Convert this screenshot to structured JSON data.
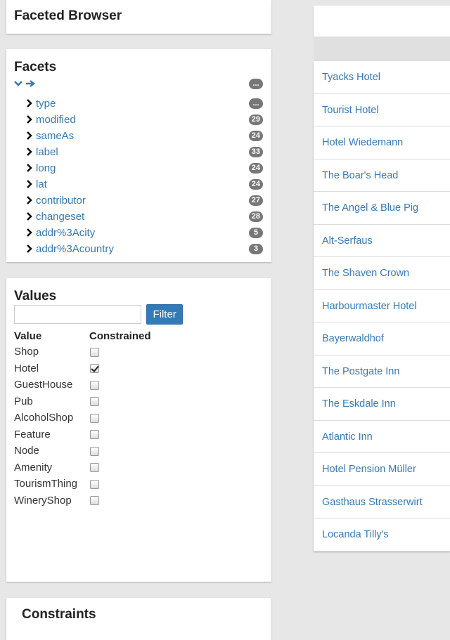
{
  "header": {
    "title": "Faceted Browser"
  },
  "facets": {
    "title": "Facets",
    "root_badge": "...",
    "items": [
      {
        "label": "type",
        "count": "..."
      },
      {
        "label": "modified",
        "count": "29"
      },
      {
        "label": "sameAs",
        "count": "24"
      },
      {
        "label": "label",
        "count": "33"
      },
      {
        "label": "long",
        "count": "24"
      },
      {
        "label": "lat",
        "count": "24"
      },
      {
        "label": "contributor",
        "count": "27"
      },
      {
        "label": "changeset",
        "count": "28"
      },
      {
        "label": "addr%3Acity",
        "count": "5"
      },
      {
        "label": "addr%3Acountry",
        "count": "3"
      }
    ]
  },
  "values": {
    "title": "Values",
    "filter_value": "",
    "filter_button": "Filter",
    "col_value": "Value",
    "col_constrained": "Constrained",
    "rows": [
      {
        "value": "Shop",
        "checked": false
      },
      {
        "value": "Hotel",
        "checked": true
      },
      {
        "value": "GuestHouse",
        "checked": false
      },
      {
        "value": "Pub",
        "checked": false
      },
      {
        "value": "AlcoholShop",
        "checked": false
      },
      {
        "value": "Feature",
        "checked": false
      },
      {
        "value": "Node",
        "checked": false
      },
      {
        "value": "Amenity",
        "checked": false
      },
      {
        "value": "TourismThing",
        "checked": false
      },
      {
        "value": "WineryShop",
        "checked": false
      }
    ]
  },
  "constraints": {
    "title": "Constraints"
  },
  "results": [
    "Tyacks Hotel",
    "Tourist Hotel",
    "Hotel Wiedemann",
    "The Boar's Head",
    "The Angel & Blue Pig",
    "Alt-Serfaus",
    "The Shaven Crown",
    "Harbourmaster Hotel",
    "Bayerwaldhof",
    "The Postgate Inn",
    "The Eskdale Inn",
    "Atlantic Inn",
    "Hotel Pension Müller",
    "Gasthaus Strasserwirt",
    "Locanda Tilly's"
  ],
  "colors": {
    "link": "#337ab7",
    "badge": "#777777",
    "button": "#337ab7"
  }
}
